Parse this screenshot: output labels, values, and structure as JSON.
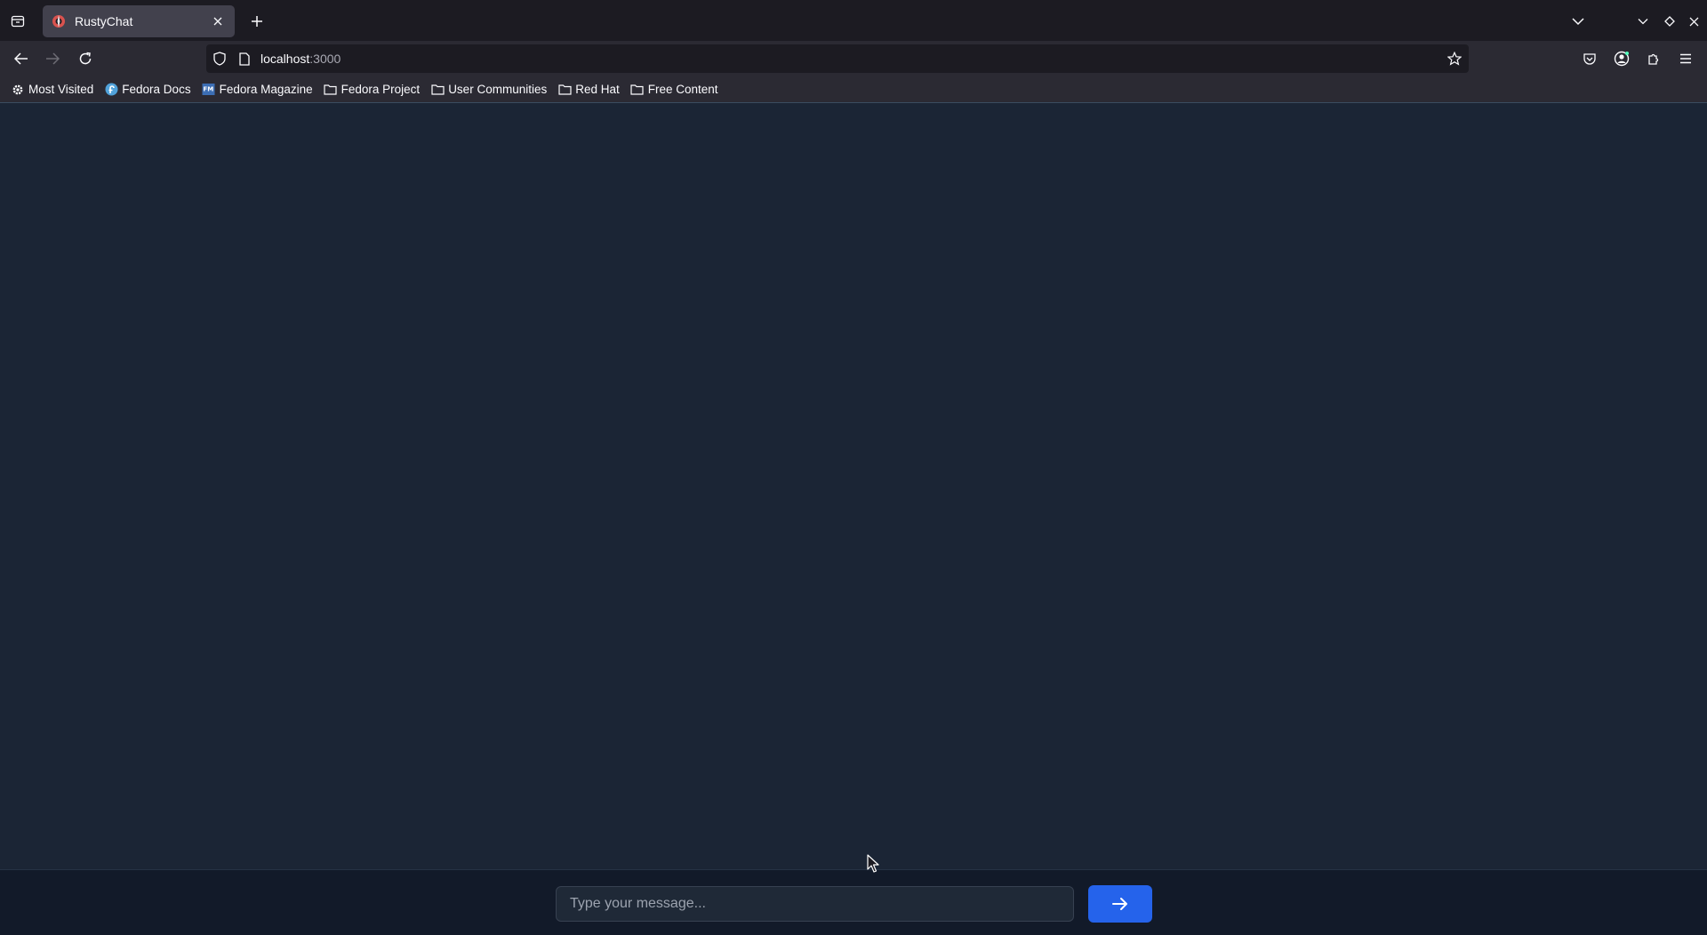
{
  "browser": {
    "tab": {
      "title": "RustyChat"
    },
    "url": {
      "host": "localhost",
      "port": ":3000"
    },
    "bookmarks": [
      {
        "label": "Most Visited",
        "icon": "gear-icon"
      },
      {
        "label": "Fedora Docs",
        "icon": "fedora-icon"
      },
      {
        "label": "Fedora Magazine",
        "icon": "fedora-magazine-icon"
      },
      {
        "label": "Fedora Project",
        "icon": "folder-icon"
      },
      {
        "label": "User Communities",
        "icon": "folder-icon"
      },
      {
        "label": "Red Hat",
        "icon": "folder-icon"
      },
      {
        "label": "Free Content",
        "icon": "folder-icon"
      }
    ]
  },
  "composer": {
    "placeholder": "Type your message...",
    "value": "",
    "send_icon": "arrow-right-icon"
  },
  "colors": {
    "page_bg": "#1b2535",
    "composer_bg": "#121a29",
    "send_button": "#2563eb"
  }
}
